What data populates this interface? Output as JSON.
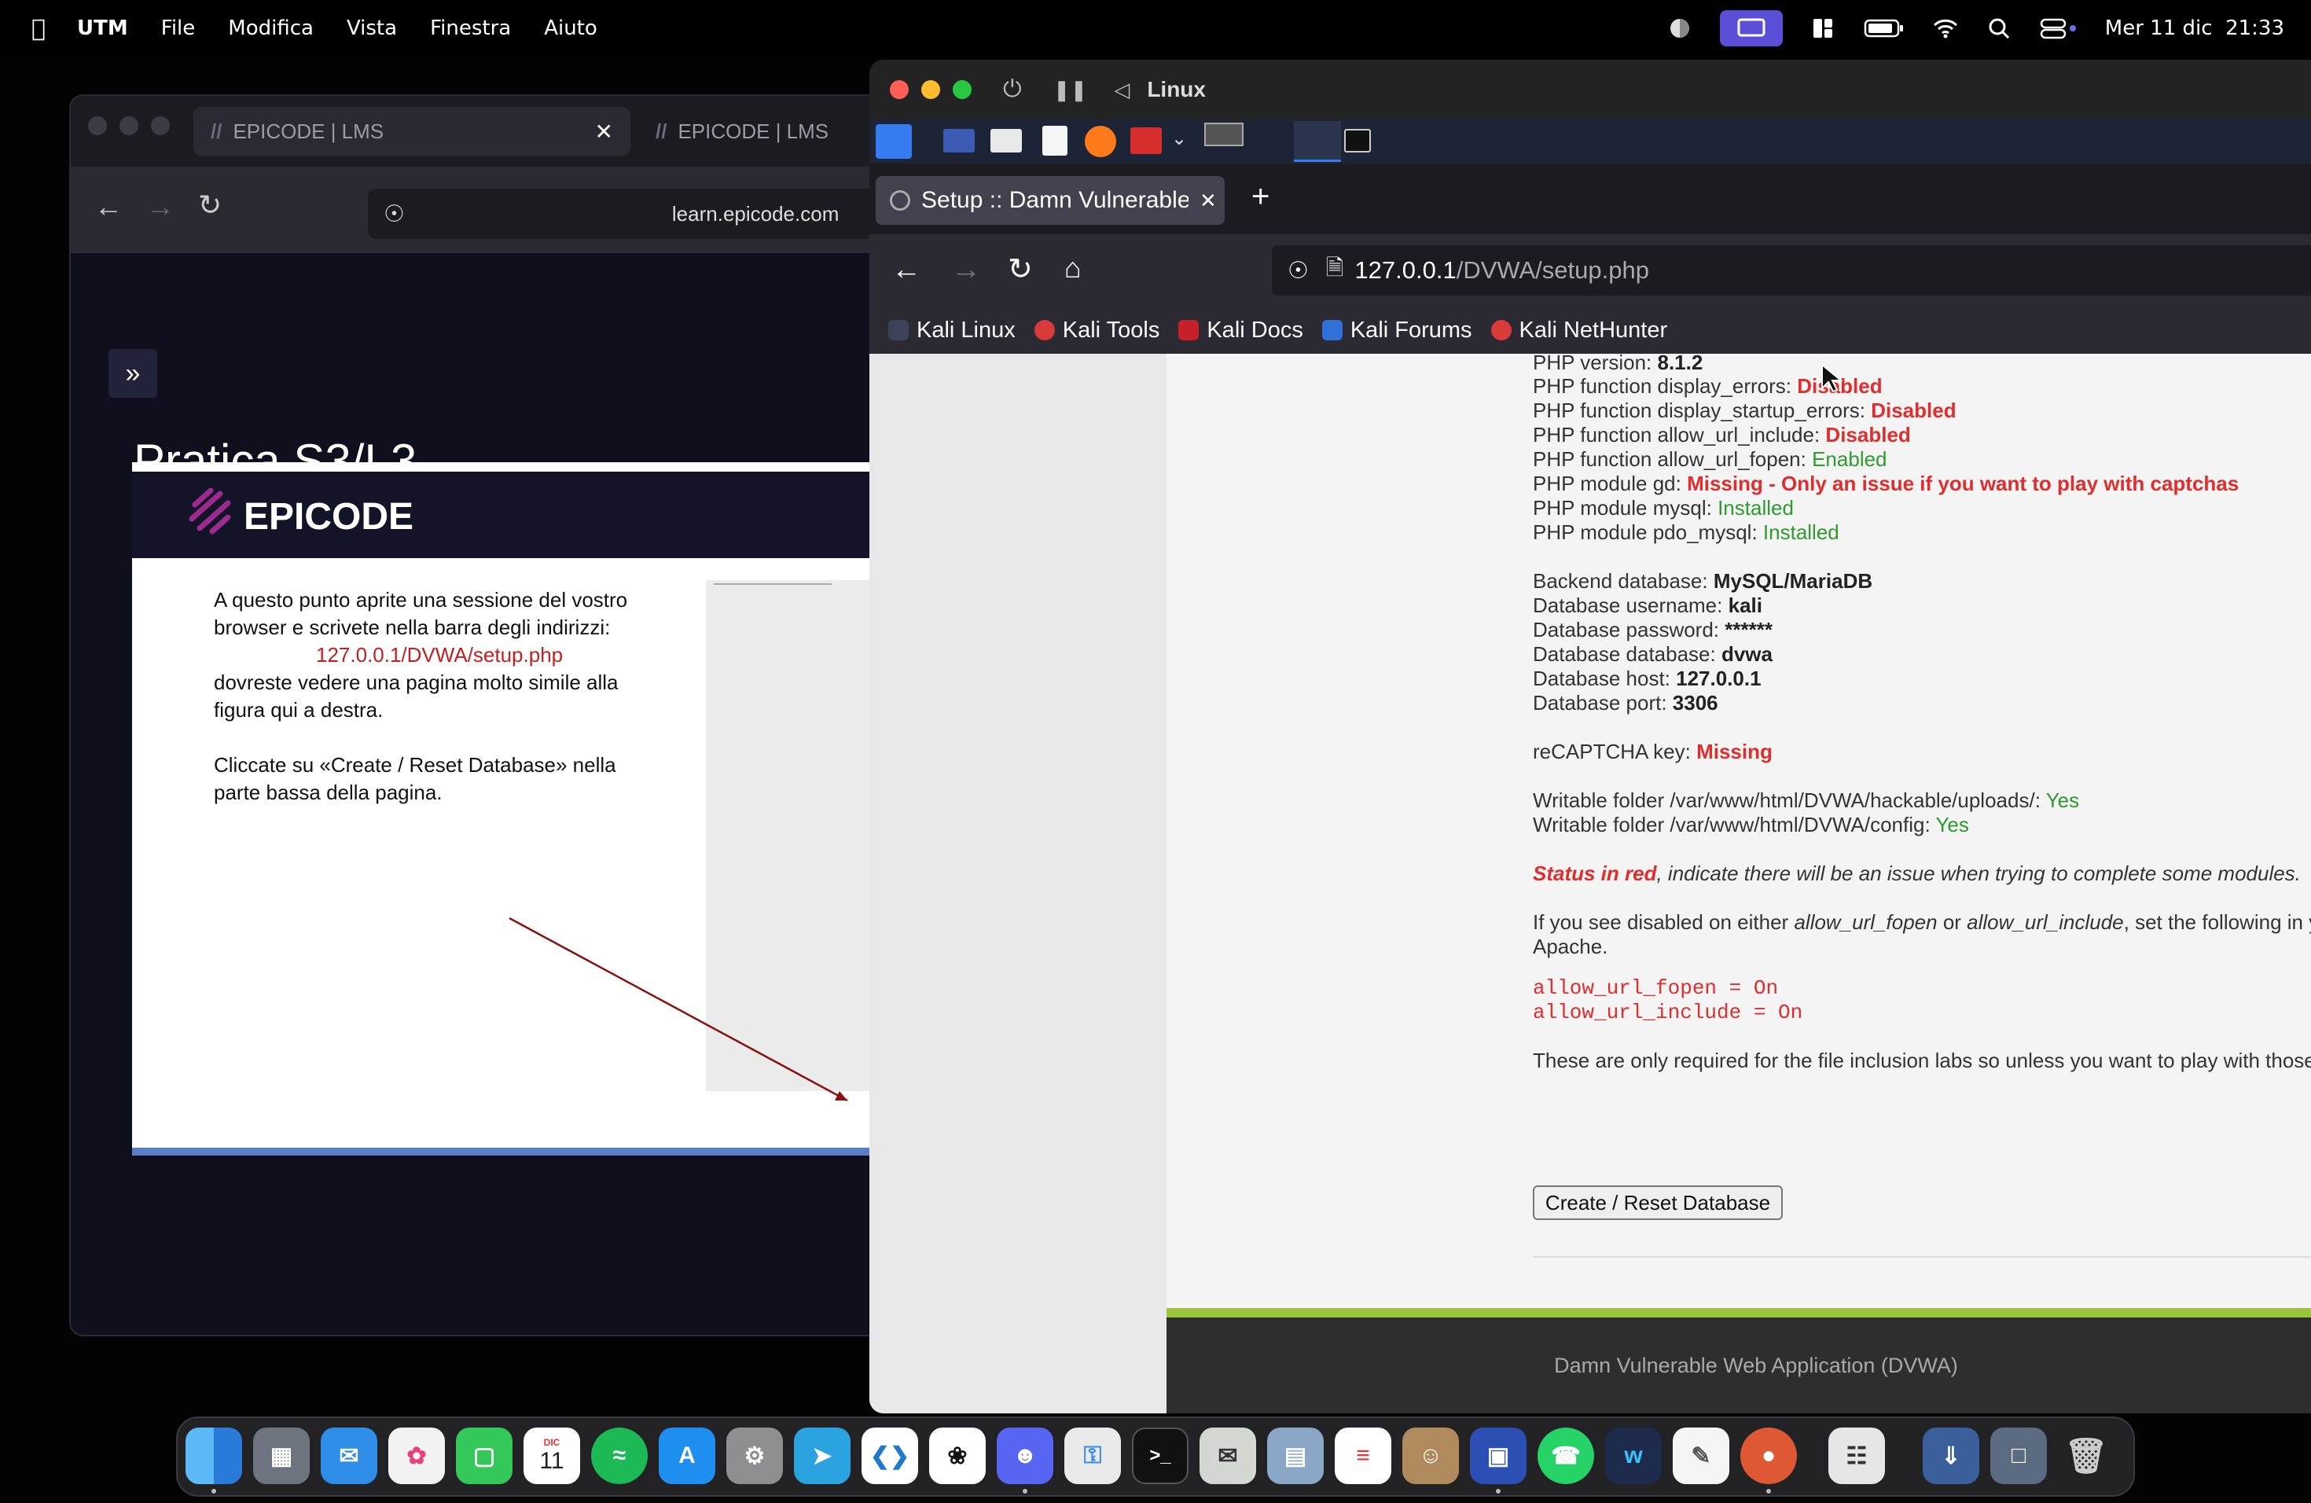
{
  "menubar": {
    "app": "UTM",
    "items": [
      "File",
      "Modifica",
      "Vista",
      "Finestra",
      "Aiuto"
    ],
    "clock": "Mer 11 dic  21:33"
  },
  "left_browser": {
    "tab1": "EPICODE | LMS",
    "tab2": "EPICODE | LMS",
    "url": "learn.epicode.com",
    "heading": "Pratica S3/L3",
    "logo_text": "EPICODE",
    "text1": "A questo punto aprite una sessione del vostro",
    "text2": "browser e scrivete nella barra degli indirizzi:",
    "text3": "127.0.0.1/DVWA/setup.php",
    "text4": "dovreste vedere una pagina molto simile alla",
    "text5": "figura qui a destra.",
    "text6": "Cliccate su «Create / Reset Database» nella",
    "text7": "parte bassa della pagina."
  },
  "vm": {
    "title": "Linux",
    "tab_title": "Setup :: Damn Vulnerable",
    "url_host": "127.0.0.1",
    "url_path": "/DVWA/setup.php",
    "bookmarks": [
      "Kali Linux",
      "Kali Tools",
      "Kali Docs",
      "Kali Forums",
      "Kali NetHunter"
    ]
  },
  "dvwa": {
    "php_version_label": "PHP version:",
    "php_version": "8.1.2",
    "display_errors_label": "PHP function display_errors:",
    "display_errors": "Disabled",
    "display_startup_label": "PHP function display_startup_errors:",
    "display_startup": "Disabled",
    "url_include_label": "PHP function allow_url_include:",
    "url_include": "Disabled",
    "url_fopen_label": "PHP function allow_url_fopen:",
    "url_fopen": "Enabled",
    "gd_label": "PHP module gd:",
    "gd": "Missing - Only an issue if you want to play with captchas",
    "mysql_label": "PHP module mysql:",
    "mysql": "Installed",
    "pdo_label": "PHP module pdo_mysql:",
    "pdo": "Installed",
    "backend_label": "Backend database:",
    "backend": "MySQL/MariaDB",
    "user_label": "Database username:",
    "user": "kali",
    "pass_label": "Database password:",
    "pass": "******",
    "db_label": "Database database:",
    "db": "dvwa",
    "host_label": "Database host:",
    "host": "127.0.0.1",
    "port_label": "Database port:",
    "port": "3306",
    "recaptcha_label": "reCAPTCHA key:",
    "recaptcha": "Missing",
    "upload_label": "Writable folder /var/www/html/DVWA/hackable/uploads/:",
    "upload": "Yes",
    "config_label": "Writable folder /var/www/html/DVWA/config:",
    "config": "Yes",
    "status_red": "Status in red",
    "status_rest": ", indicate there will be an issue when trying to complete some modules.",
    "disabled_a": "If you see disabled on either ",
    "disabled_b": "allow_url_fopen",
    "disabled_c": " or ",
    "disabled_d": "allow_url_include",
    "disabled_e": ", set the following in your php.ini file and restart",
    "apache": "Apache.",
    "code1": "allow_url_fopen = On",
    "code2": "allow_url_include = On",
    "note": "These are only required for the file inclusion labs so unless you want to play with those, you can ignore them.",
    "button": "Create / Reset Database",
    "footer": "Damn Vulnerable Web Application (DVWA)"
  },
  "dock_icons": [
    "finder",
    "launchpad",
    "mail",
    "photos",
    "facetime",
    "calendar",
    "spotify",
    "app-store",
    "system-settings",
    "telegram",
    "vscode",
    "chatgpt",
    "discord",
    "keychain",
    "terminal",
    "activity-monitor",
    "preview",
    "reminders",
    "contacts",
    "utm",
    "whatsapp",
    "webex",
    "textedit",
    "duckduckgo",
    "utm-vm",
    "downloads",
    "screenshots",
    "trash"
  ],
  "calendar": {
    "month": "DIC",
    "day": "11"
  }
}
